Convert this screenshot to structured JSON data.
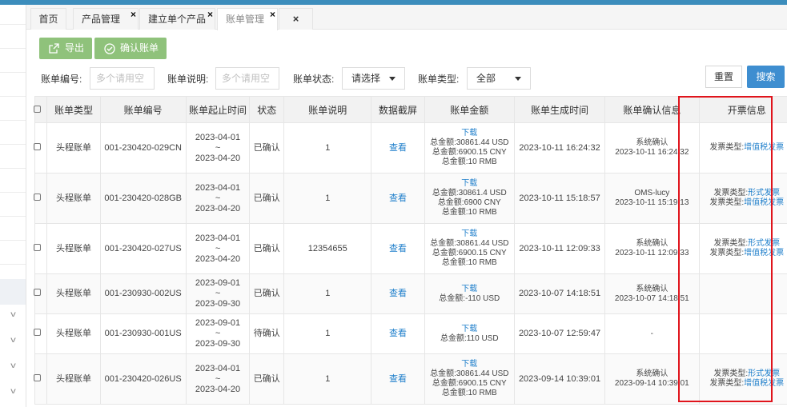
{
  "tabs": [
    {
      "label": "首页",
      "closable": false
    },
    {
      "label": "产品管理",
      "closable": true
    },
    {
      "label": "建立单个产品",
      "closable": true
    },
    {
      "label": "账单管理",
      "closable": true,
      "active": true
    },
    {
      "label": "",
      "closable": true
    }
  ],
  "toolbar": {
    "export_label": "导出",
    "confirm_label": "确认账单"
  },
  "filters": {
    "bill_no_label": "账单编号:",
    "bill_no_placeholder": "多个请用空",
    "bill_desc_label": "账单说明:",
    "bill_desc_placeholder": "多个请用空",
    "status_label": "账单状态:",
    "status_value": "请选择",
    "type_label": "账单类型:",
    "type_value": "全部",
    "reset_label": "重置",
    "search_label": "搜索"
  },
  "table": {
    "headers": [
      "",
      "账单类型",
      "账单编号",
      "账单起止时间",
      "状态",
      "账单说明",
      "数据截屏",
      "账单金额",
      "账单生成时间",
      "账单确认信息",
      "开票信息"
    ],
    "rows": [
      {
        "type": "头程账单",
        "no": "001-230420-029CN",
        "start": "2023-04-01",
        "tilde": "~",
        "end": "2023-04-20",
        "status": "已确认",
        "desc": "1",
        "shot": "查看",
        "amount": [
          "下载",
          "总金额:30861.44 USD",
          "总金额:6900.15 CNY",
          "总金额:10 RMB"
        ],
        "created": "2023-10-11 16:24:32",
        "confirm": [
          "系统确认",
          "2023-10-11 16:24:32"
        ],
        "invoice": [
          "发票类型:",
          "增值税发票"
        ],
        "invoice2": []
      },
      {
        "type": "头程账单",
        "no": "001-230420-028GB",
        "start": "2023-04-01",
        "tilde": "~",
        "end": "2023-04-20",
        "status": "已确认",
        "desc": "1",
        "shot": "查看",
        "amount": [
          "下载",
          "总金额:30861.4 USD",
          "总金额:6900 CNY",
          "总金额:10 RMB"
        ],
        "created": "2023-10-11 15:18:57",
        "confirm": [
          "OMS-lucy",
          "2023-10-11 15:19:13"
        ],
        "invoice": [
          "发票类型:",
          "形式发票"
        ],
        "invoice2": [
          "发票类型:",
          "增值税发票"
        ]
      },
      {
        "type": "头程账单",
        "no": "001-230420-027US",
        "start": "2023-04-01",
        "tilde": "~",
        "end": "2023-04-20",
        "status": "已确认",
        "desc": "12354655",
        "shot": "查看",
        "amount": [
          "下载",
          "总金额:30861.44 USD",
          "总金额:6900.15 CNY",
          "总金额:10 RMB"
        ],
        "created": "2023-10-11 12:09:33",
        "confirm": [
          "系统确认",
          "2023-10-11 12:09:33"
        ],
        "invoice": [
          "发票类型:",
          "形式发票"
        ],
        "invoice2": [
          "发票类型:",
          "增值税发票"
        ]
      },
      {
        "type": "头程账单",
        "no": "001-230930-002US",
        "start": "2023-09-01",
        "tilde": "~",
        "end": "2023-09-30",
        "status": "已确认",
        "desc": "1",
        "shot": "查看",
        "amount": [
          "下载",
          "总金额:-110 USD"
        ],
        "created": "2023-10-07 14:18:51",
        "confirm": [
          "系统确认",
          "2023-10-07 14:18:51"
        ],
        "invoice": [],
        "invoice2": []
      },
      {
        "type": "头程账单",
        "no": "001-230930-001US",
        "start": "2023-09-01",
        "tilde": "~",
        "end": "2023-09-30",
        "status": "待确认",
        "desc": "1",
        "shot": "查看",
        "amount": [
          "下载",
          "总金额:110 USD"
        ],
        "created": "2023-10-07 12:59:47",
        "confirm": [
          "-"
        ],
        "invoice": [],
        "invoice2": []
      },
      {
        "type": "头程账单",
        "no": "001-230420-026US",
        "start": "2023-04-01",
        "tilde": "~",
        "end": "2023-04-20",
        "status": "已确认",
        "desc": "1",
        "shot": "查看",
        "amount": [
          "下载",
          "总金额:30861.44 USD",
          "总金额:6900.15 CNY",
          "总金额:10 RMB"
        ],
        "created": "2023-09-14 10:39:01",
        "confirm": [
          "系统确认",
          "2023-09-14 10:39:01"
        ],
        "invoice": [
          "发票类型:",
          "形式发票"
        ],
        "invoice2": [
          "发票类型:",
          "增值税发票"
        ]
      }
    ]
  },
  "colors": {
    "accent": "#3e8ed0",
    "green_button": "#8fc27b",
    "link": "#1f7fcb",
    "highlight_box": "#e0141c"
  }
}
